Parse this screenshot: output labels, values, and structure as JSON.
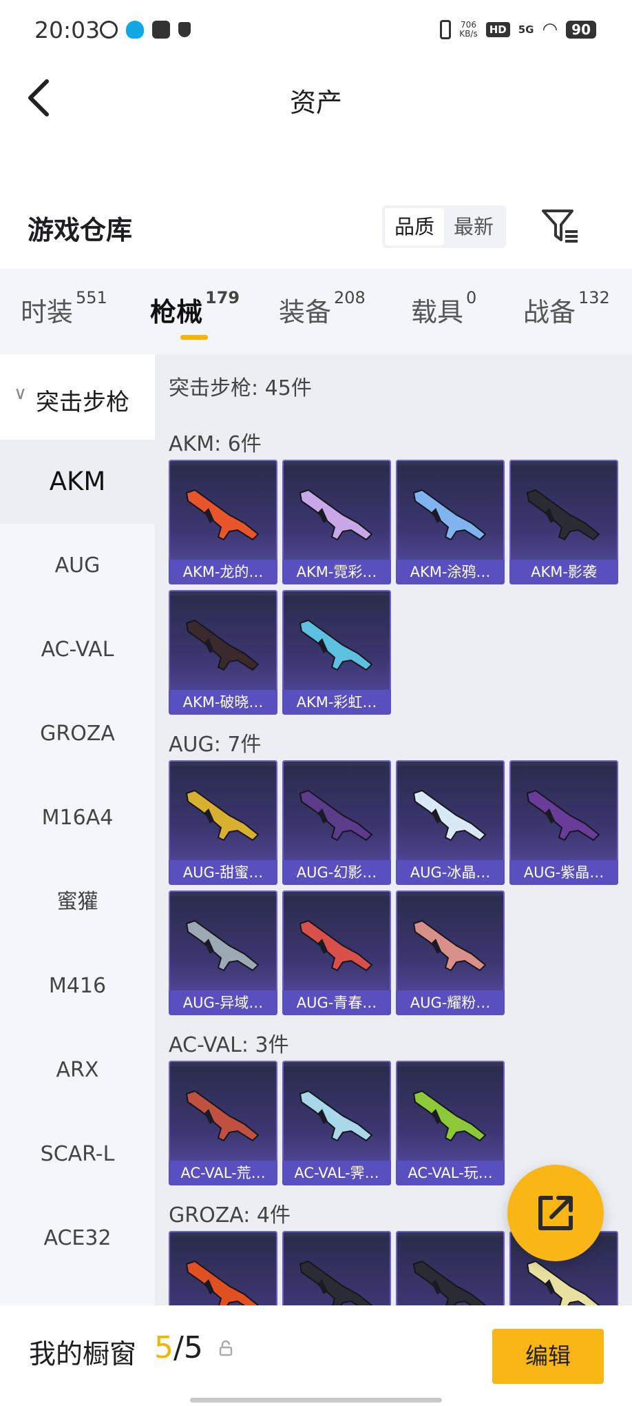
{
  "status_bar": {
    "time": "20:03",
    "net_speed": "706",
    "net_unit": "KB/s",
    "hd": "HD",
    "signal": "5G",
    "battery": "90"
  },
  "header": {
    "title": "资产"
  },
  "warehouse": {
    "title": "游戏仓库",
    "sort_options": [
      "品质",
      "最新"
    ],
    "active_sort": "品质"
  },
  "tabs": [
    {
      "label": "时装",
      "count": "551"
    },
    {
      "label": "枪械",
      "count": "179",
      "active": true
    },
    {
      "label": "装备",
      "count": "208"
    },
    {
      "label": "载具",
      "count": "0"
    },
    {
      "label": "战备",
      "count": "132"
    }
  ],
  "sidebar": {
    "category": "突击步枪",
    "items": [
      "AKM",
      "AUG",
      "AC-VAL",
      "GROZA",
      "M16A4",
      "蜜獾",
      "M416",
      "ARX",
      "SCAR-L",
      "ACE32"
    ],
    "active": "AKM"
  },
  "content": {
    "summary": "突击步枪: 45件",
    "groups": [
      {
        "title": "AKM: 6件",
        "items": [
          "AKM-龙的…",
          "AKM-霓彩…",
          "AKM-涂鸦…",
          "AKM-影袭",
          "AKM-破晓…",
          "AKM-彩虹…"
        ]
      },
      {
        "title": "AUG: 7件",
        "items": [
          "AUG-甜蜜…",
          "AUG-幻影…",
          "AUG-冰晶…",
          "AUG-紫晶…",
          "AUG-异域…",
          "AUG-青春…",
          "AUG-耀粉…"
        ]
      },
      {
        "title": "AC-VAL: 3件",
        "items": [
          "AC-VAL-荒…",
          "AC-VAL-霁…",
          "AC-VAL-玩…"
        ]
      },
      {
        "title": "GROZA: 4件",
        "items": [
          "",
          "",
          "",
          ""
        ]
      }
    ],
    "gun_colors": [
      "#e8552a",
      "#c9a8e8",
      "#7fb4f0",
      "#2b2b33",
      "#3a2a2e",
      "#5ec0e0",
      "#d7b030",
      "#5a3c8a",
      "#d8e8f4",
      "#6a3c9a",
      "#9ca8b4",
      "#d8504a",
      "#d89088",
      "#c05040",
      "#a8d8e8",
      "#8cc838",
      "#e05020",
      "#2b2b33",
      "#2b2b33",
      "#e8e0a0"
    ]
  },
  "bottom_bar": {
    "label": "我的橱窗",
    "count_current": "5",
    "count_sep": "/",
    "count_total": "5",
    "edit_label": "编辑"
  },
  "icons": {
    "back": "back-arrow-icon",
    "filter": "filter-icon",
    "fab": "share-icon",
    "lock": "lock-icon"
  }
}
